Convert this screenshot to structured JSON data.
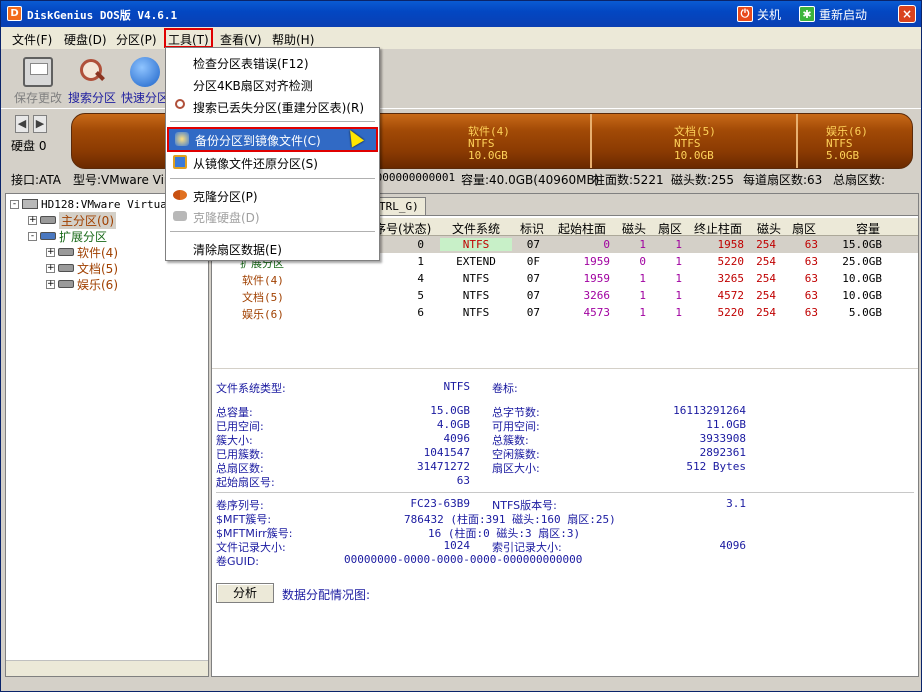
{
  "window": {
    "title": "DiskGenius DOS版 V4.6.1"
  },
  "titlebar": {
    "shutdown_label": "关机",
    "restart_label": "重新启动",
    "close_glyph": "×",
    "app_icon_glyph": "D"
  },
  "menubar": {
    "items": [
      "文件(F)",
      "硬盘(D)",
      "分区(P)",
      "工具(T)",
      "查看(V)",
      "帮助(H)"
    ]
  },
  "toolbar": {
    "save_label": "保存更改",
    "search_label": "搜索分区",
    "quick_label": "快速分区"
  },
  "diskbar": {
    "disk_label": "硬盘 0",
    "prev_glyph": "◀",
    "next_glyph": "▶",
    "segments": [
      {
        "name": "软件(4)",
        "fs": "NTFS",
        "size": "10.0GB"
      },
      {
        "name": "文档(5)",
        "fs": "NTFS",
        "size": "10.0GB"
      },
      {
        "name": "娱乐(6)",
        "fs": "NTFS",
        "size": "5.0GB"
      }
    ]
  },
  "infobar": {
    "interface": "接口:ATA",
    "model": "型号:VMware Virt",
    "serial_tail": "0000000000001",
    "capacity": "容量:40.0GB(40960MB)",
    "cylinders": "柱面数:5221",
    "heads": "磁头数:255",
    "sectors_per_track": "每道扇区数:63",
    "total_sectors": "总扇区数:"
  },
  "tree": {
    "disk": "HD128:VMware Virtual",
    "primary": "主分区(0)",
    "extended": "扩展分区",
    "logical": [
      "软件(4)",
      "文档(5)",
      "娱乐(6)"
    ],
    "expand_glyph": "+",
    "collapse_glyph": "-"
  },
  "tabs": {
    "tab1": "TRL_G)"
  },
  "partition_table": {
    "headers": [
      "序号(状态)",
      "文件系统",
      "标识",
      "起始柱面",
      "磁头",
      "扇区",
      "终止柱面",
      "磁头",
      "扇区",
      "容量"
    ],
    "rows": [
      {
        "name": "",
        "index": "0",
        "fs": "NTFS",
        "id": "07",
        "start_cyl": "0",
        "start_head": "1",
        "start_sec": "1",
        "end_cyl": "1958",
        "end_head": "254",
        "end_sec": "63",
        "size": "15.0GB"
      },
      {
        "name": "扩展分区",
        "index": "1",
        "fs": "EXTEND",
        "id": "0F",
        "start_cyl": "1959",
        "start_head": "0",
        "start_sec": "1",
        "end_cyl": "5220",
        "end_head": "254",
        "end_sec": "63",
        "size": "25.0GB"
      },
      {
        "name": "软件(4)",
        "index": "4",
        "fs": "NTFS",
        "id": "07",
        "start_cyl": "1959",
        "start_head": "1",
        "start_sec": "1",
        "end_cyl": "3265",
        "end_head": "254",
        "end_sec": "63",
        "size": "10.0GB"
      },
      {
        "name": "文档(5)",
        "index": "5",
        "fs": "NTFS",
        "id": "07",
        "start_cyl": "3266",
        "start_head": "1",
        "start_sec": "1",
        "end_cyl": "4572",
        "end_head": "254",
        "end_sec": "63",
        "size": "10.0GB"
      },
      {
        "name": "娱乐(6)",
        "index": "6",
        "fs": "NTFS",
        "id": "07",
        "start_cyl": "4573",
        "start_head": "1",
        "start_sec": "1",
        "end_cyl": "5220",
        "end_head": "254",
        "end_sec": "63",
        "size": "5.0GB"
      }
    ]
  },
  "details": {
    "fs_type_label": "文件系统类型:",
    "fs_type": "NTFS",
    "volume_label_label": "卷标:",
    "total_size_label": "总容量:",
    "total_size": "15.0GB",
    "total_bytes_label": "总字节数:",
    "total_bytes": "16113291264",
    "used_label": "已用空间:",
    "used": "4.0GB",
    "free_label": "可用空间:",
    "free": "11.0GB",
    "cluster_size_label": "簇大小:",
    "cluster_size": "4096",
    "total_clusters_label": "总簇数:",
    "total_clusters": "3933908",
    "used_clusters_label": "已用簇数:",
    "used_clusters": "1041547",
    "free_clusters_label": "空闲簇数:",
    "free_clusters": "2892361",
    "total_sectors_label": "总扇区数:",
    "total_sectors": "31471272",
    "sector_size_label": "扇区大小:",
    "sector_size": "512 Bytes",
    "start_sector_label": "起始扇区号:",
    "start_sector": "63",
    "serial_label": "卷序列号:",
    "serial": "FC23-63B9",
    "ntfs_ver_label": "NTFS版本号:",
    "ntfs_ver": "3.1",
    "mft_label": "$MFT簇号:",
    "mft": "786432 (柱面:391 磁头:160 扇区:25)",
    "mftmirr_label": "$MFTMirr簇号:",
    "mftmirr": "16 (柱面:0 磁头:3 扇区:3)",
    "record_size_label": "文件记录大小:",
    "record_size": "1024",
    "index_size_label": "索引记录大小:",
    "index_size": "4096",
    "guid_label": "卷GUID:",
    "guid": "00000000-0000-0000-0000-000000000000",
    "analyze_button": "分析",
    "distribution_label": "数据分配情况图:"
  },
  "dropdown": {
    "items": [
      {
        "label": "检查分区表错误(F12)"
      },
      {
        "label": "分区4KB扇区对齐检测"
      },
      {
        "label": "搜索已丢失分区(重建分区表)(R)"
      },
      {
        "label": "备份分区到镜像文件(C)"
      },
      {
        "label": "从镜像文件还原分区(S)"
      },
      {
        "label": "克隆分区(P)"
      },
      {
        "label": "克隆硬盘(D)"
      },
      {
        "label": "清除扇区数据(E)"
      }
    ]
  },
  "colors": {
    "title_blue": "#0a4fc8",
    "menu_highlight": "#316ac5",
    "red_outline": "#e00000",
    "disk_orange": "#a24a06",
    "segment_text": "#ffd35a"
  }
}
